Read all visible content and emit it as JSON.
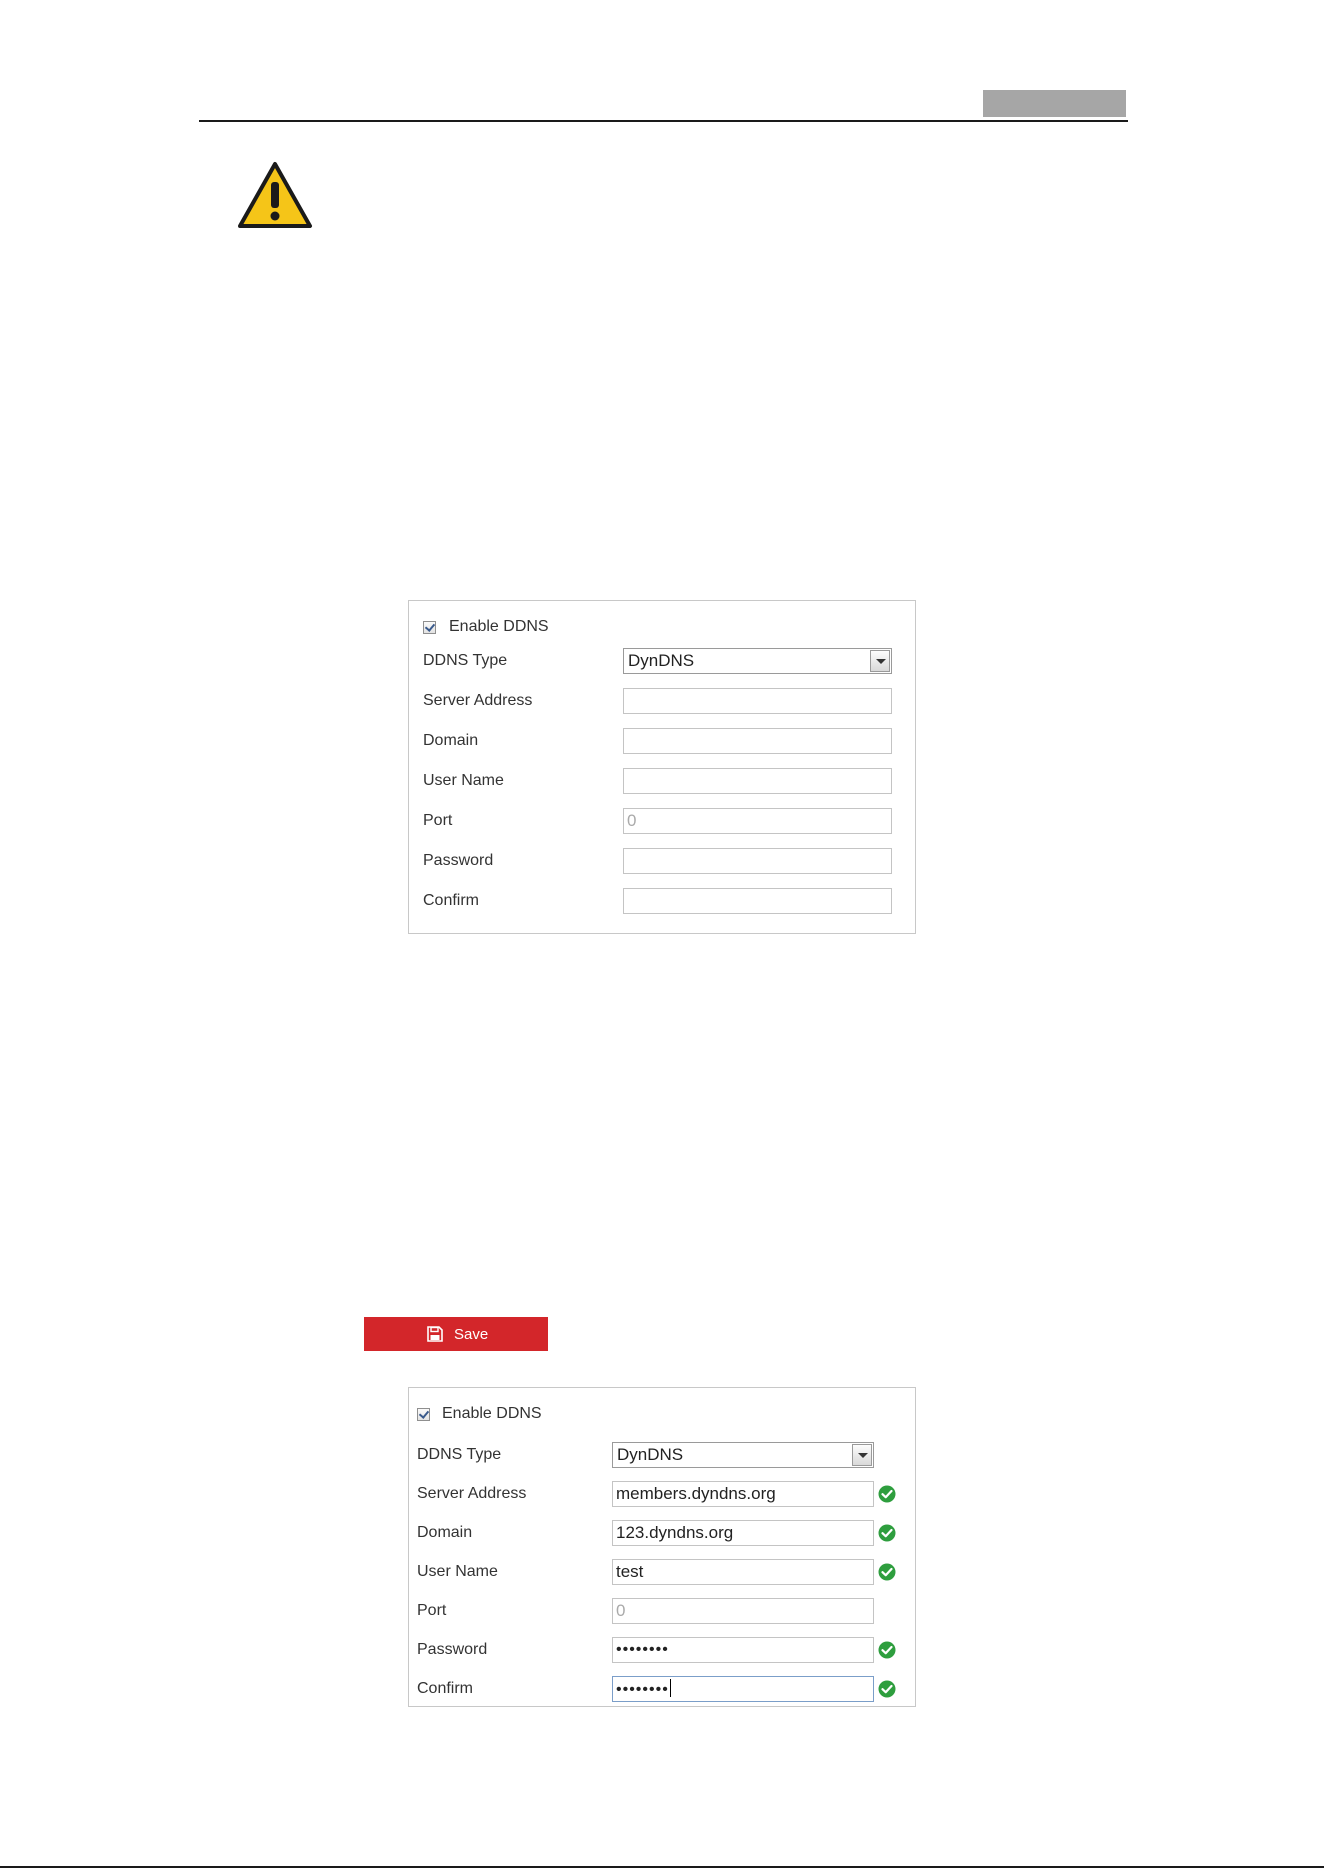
{
  "panel1": {
    "enable_label": "Enable DDNS",
    "enable_checked": true,
    "fields": {
      "ddns_type": {
        "label": "DDNS Type",
        "value": "DynDNS"
      },
      "server_address": {
        "label": "Server Address",
        "value": ""
      },
      "domain": {
        "label": "Domain",
        "value": ""
      },
      "user_name": {
        "label": "User Name",
        "value": ""
      },
      "port": {
        "label": "Port",
        "value": "0"
      },
      "password": {
        "label": "Password",
        "value": ""
      },
      "confirm": {
        "label": "Confirm",
        "value": ""
      }
    }
  },
  "save_button": {
    "label": "Save",
    "icon": "floppy-disk-icon",
    "color": "#d3262a"
  },
  "panel2": {
    "enable_label": "Enable DDNS",
    "enable_checked": true,
    "fields": {
      "ddns_type": {
        "label": "DDNS Type",
        "value": "DynDNS"
      },
      "server_address": {
        "label": "Server Address",
        "value": "members.dyndns.org"
      },
      "domain": {
        "label": "Domain",
        "value": "123.dyndns.org"
      },
      "user_name": {
        "label": "User Name",
        "value": "test"
      },
      "port": {
        "label": "Port",
        "value": "0"
      },
      "password": {
        "label": "Password",
        "value": "••••••••"
      },
      "confirm": {
        "label": "Confirm",
        "value": "••••••••"
      }
    },
    "valid_icon": "check-circle-icon",
    "valid_color": "#2e9e3e"
  },
  "icons": {
    "warning": "warning-icon",
    "warning_color": "#f5c518"
  }
}
